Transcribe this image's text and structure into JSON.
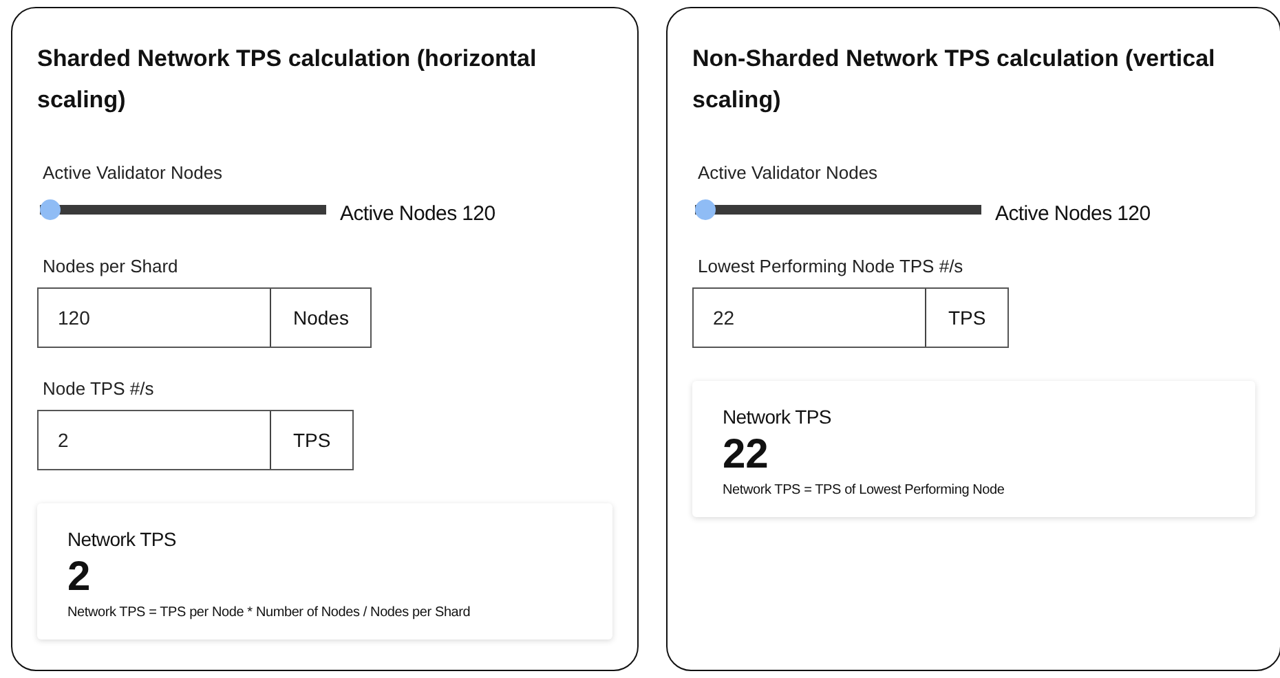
{
  "panels": [
    {
      "title": "Sharded Network TPS calculation (horizontal scaling)",
      "controls": [
        {
          "kind": "slider",
          "label": "Active Validator Nodes",
          "level": 0,
          "reading": "Active Nodes 120"
        },
        {
          "kind": "number",
          "label": "Nodes per Shard",
          "value": "120",
          "unit": "Nodes"
        },
        {
          "kind": "number",
          "label": "Node TPS #/s",
          "value": "2",
          "unit": "TPS"
        }
      ],
      "result": {
        "label": "Network TPS",
        "value": "2",
        "formula": "Network TPS = TPS per Node * Number of Nodes / Nodes per Shard"
      }
    },
    {
      "title": "Non-Sharded Network TPS calculation (vertical scaling)",
      "controls": [
        {
          "kind": "slider",
          "label": "Active Validator Nodes",
          "level": 0,
          "reading": "Active Nodes 120"
        },
        {
          "kind": "number",
          "label": "Lowest Performing Node TPS #/s",
          "value": "22",
          "unit": "TPS"
        }
      ],
      "result": {
        "label": "Network TPS",
        "value": "22",
        "formula": "Network TPS = TPS of Lowest Performing Node"
      }
    }
  ]
}
